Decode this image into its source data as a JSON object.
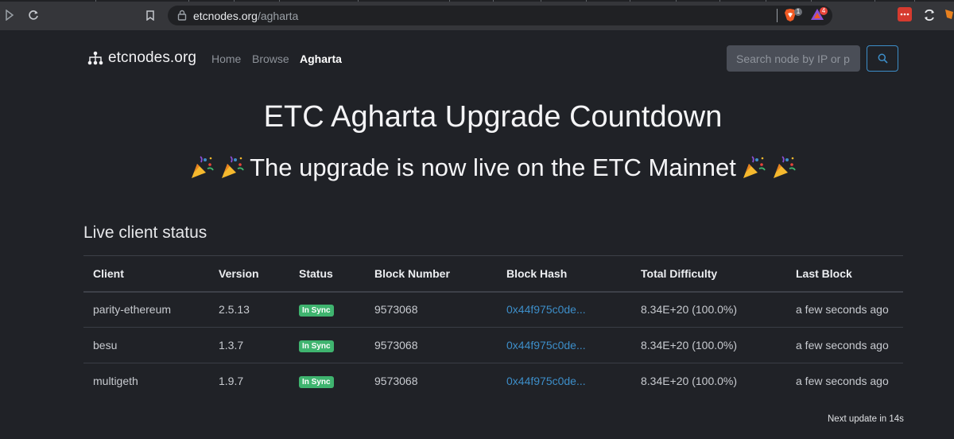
{
  "browser": {
    "url_host": "etcnodes.org",
    "url_path": "/agharta",
    "brave_badge": "1",
    "rewards_badge": "4"
  },
  "nav": {
    "brand": "etcnodes.org",
    "links": [
      "Home",
      "Browse",
      "Agharta"
    ],
    "search_placeholder": "Search node by IP or p"
  },
  "hero": {
    "title": "ETC Agharta Upgrade Countdown",
    "subtitle": "The upgrade is now live on the ETC Mainnet"
  },
  "status": {
    "section_title": "Live client status",
    "columns": [
      "Client",
      "Version",
      "Status",
      "Block Number",
      "Block Hash",
      "Total Difficulty",
      "Last Block"
    ],
    "rows": [
      {
        "client": "parity-ethereum",
        "version": "2.5.13",
        "status": "In Sync",
        "block_number": "9573068",
        "block_hash": "0x44f975c0de...",
        "total_difficulty": "8.34E+20 (100.0%)",
        "last_block": "a few seconds ago"
      },
      {
        "client": "besu",
        "version": "1.3.7",
        "status": "In Sync",
        "block_number": "9573068",
        "block_hash": "0x44f975c0de...",
        "total_difficulty": "8.34E+20 (100.0%)",
        "last_block": "a few seconds ago"
      },
      {
        "client": "multigeth",
        "version": "1.9.7",
        "status": "In Sync",
        "block_number": "9573068",
        "block_hash": "0x44f975c0de...",
        "total_difficulty": "8.34E+20 (100.0%)",
        "last_block": "a few seconds ago"
      }
    ],
    "next_update": "Next update in 14s"
  },
  "colors": {
    "background": "#202227",
    "link": "#3d8ec9",
    "in_sync": "#3fb46f"
  }
}
